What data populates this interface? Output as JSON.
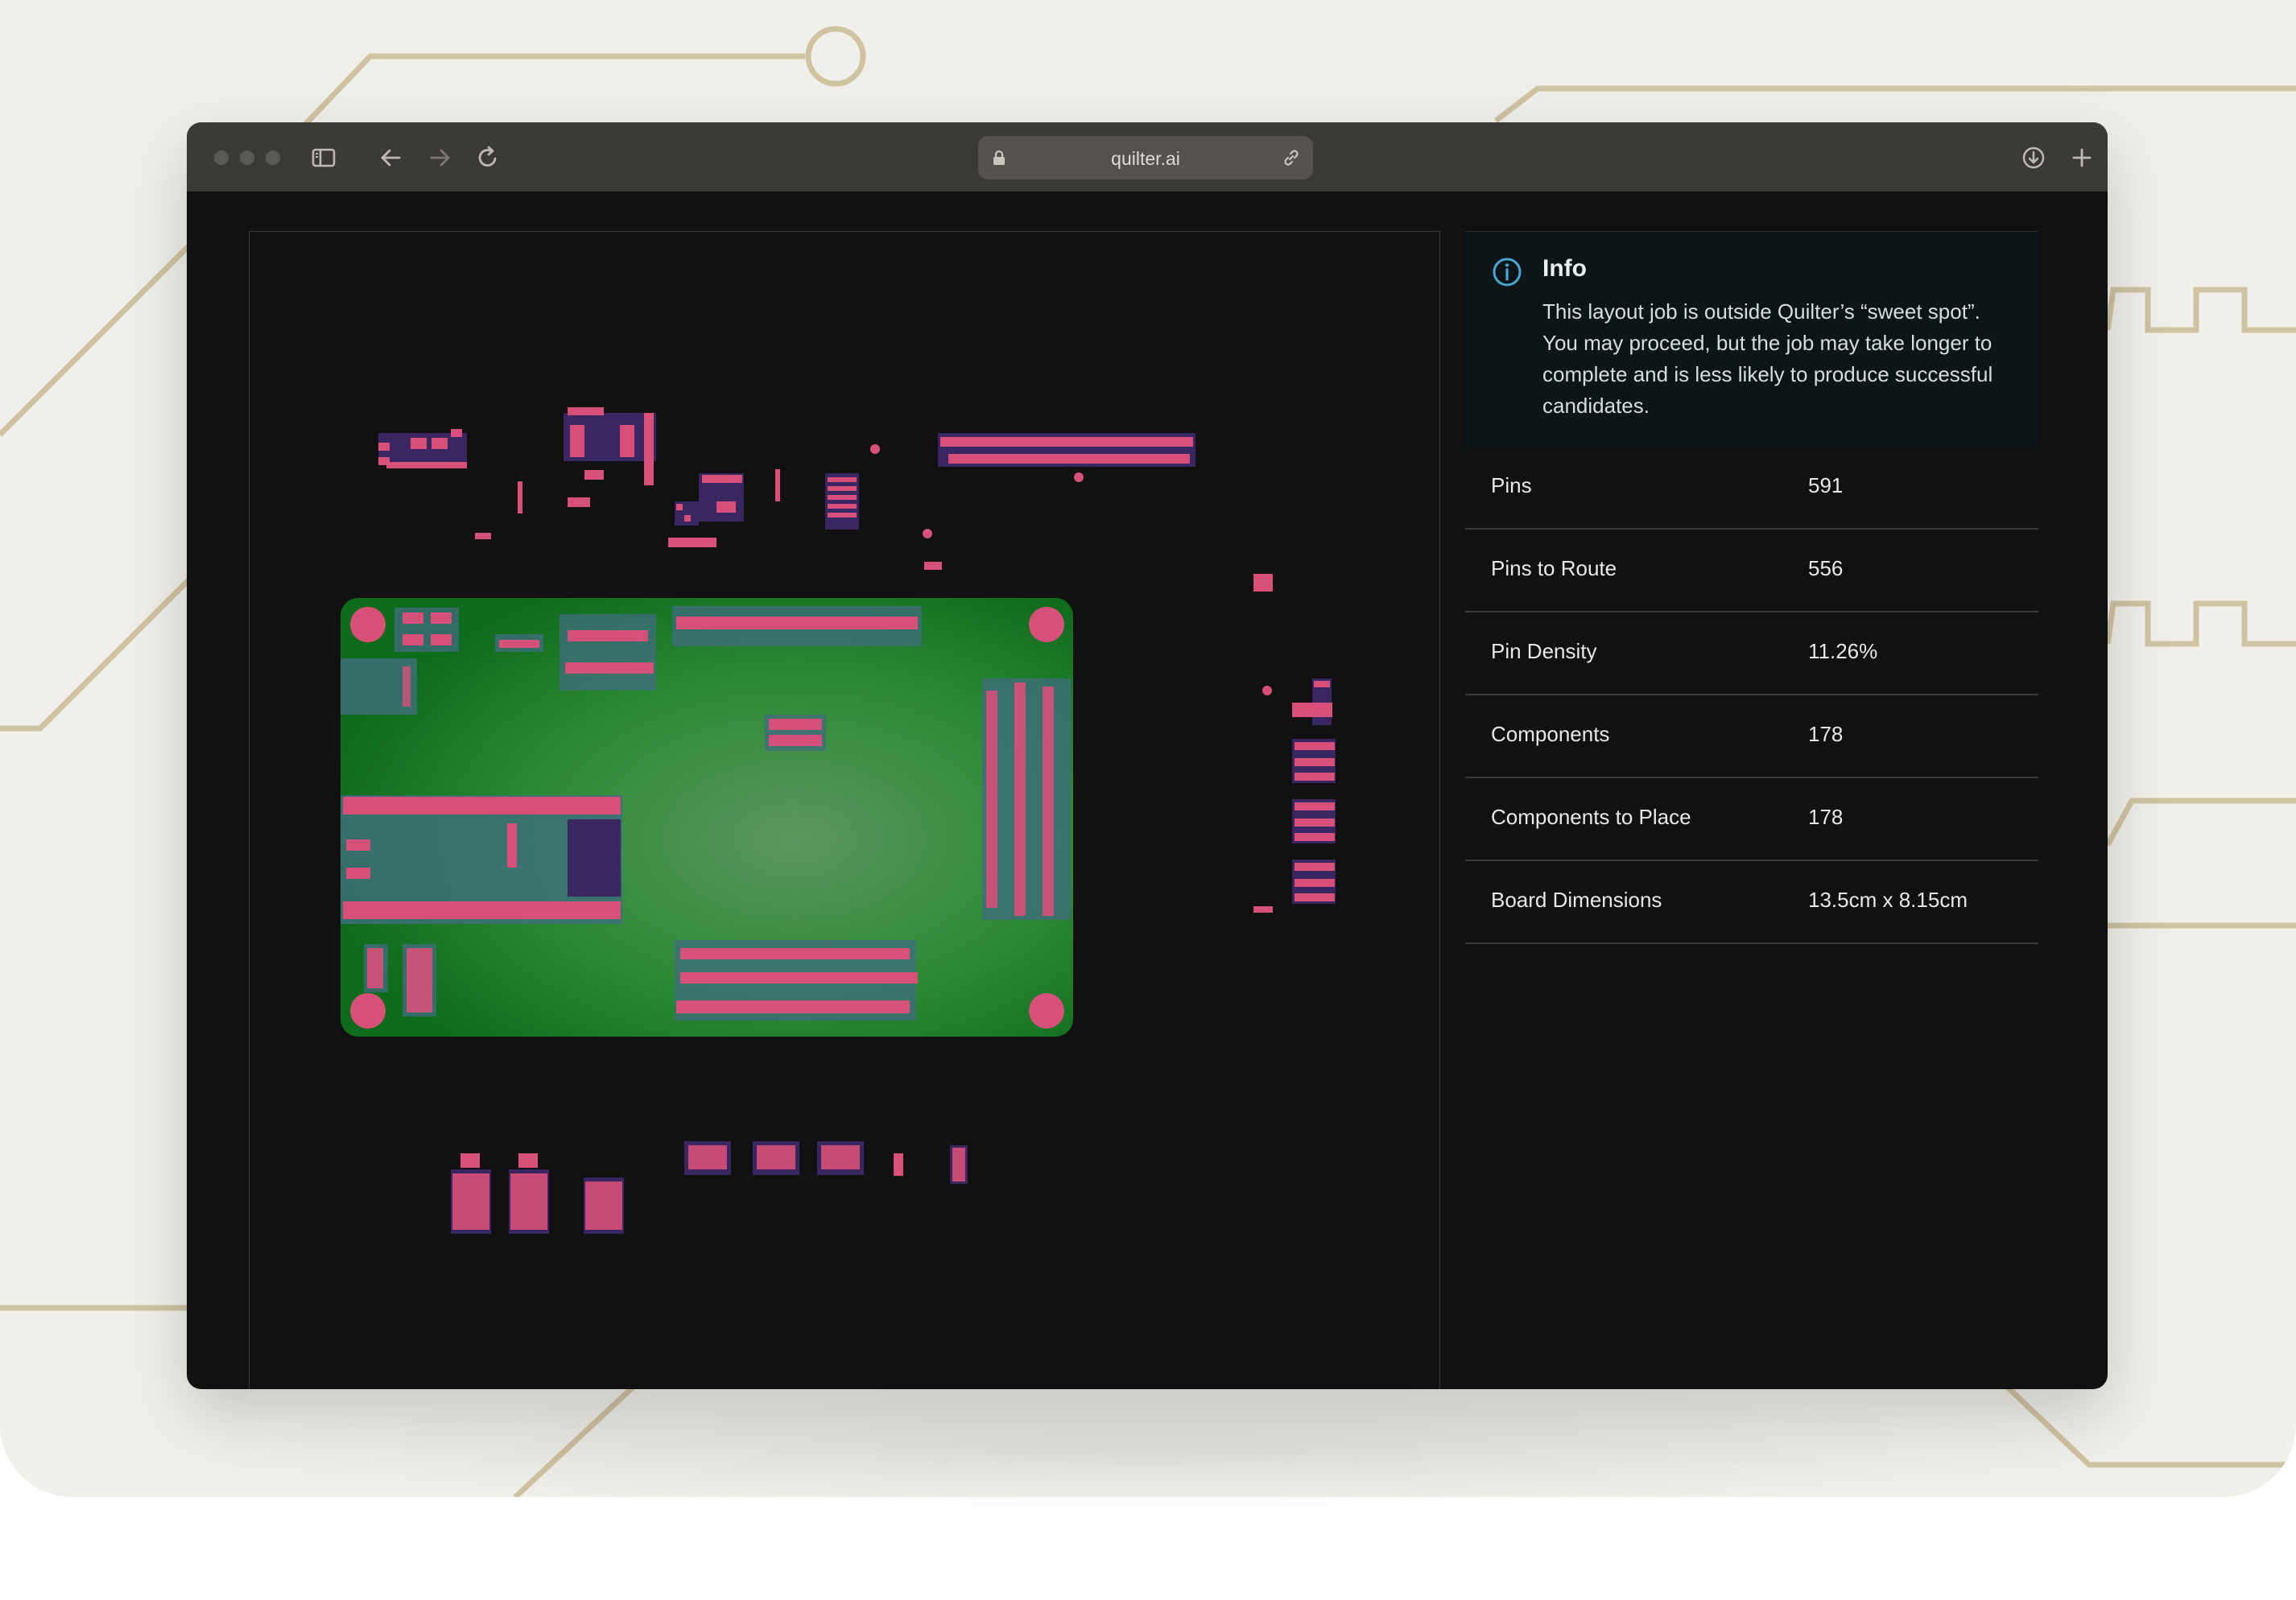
{
  "browser": {
    "url": "quilter.ai",
    "toolbar_icons": [
      "sidebar-icon",
      "back-arrow-icon",
      "forward-arrow-icon",
      "reload-icon",
      "lock-icon",
      "link-icon",
      "download-icon",
      "plus-icon"
    ]
  },
  "info": {
    "title": "Info",
    "message": "This layout job is outside Quilter’s “sweet spot”. You may proceed, but the job may take longer to complete and is less likely to produce successful candidates."
  },
  "properties": [
    {
      "label": "Pins",
      "value": "591"
    },
    {
      "label": "Pins to Route",
      "value": "556"
    },
    {
      "label": "Pin Density",
      "value": "11.26%"
    },
    {
      "label": "Components",
      "value": "178"
    },
    {
      "label": "Components to Place",
      "value": "178"
    },
    {
      "label": "Board Dimensions",
      "value": "13.5cm x 8.15cm"
    }
  ],
  "colors": {
    "background": "#f1efe9",
    "trace_decoration": "#cfc3a2",
    "toolbar": "#3c3a37",
    "canvas": "#111111",
    "board_green": "#2f9a35",
    "pad_pink": "#d7507a",
    "component_purple": "#3a2660",
    "info_accent": "#4aa6d6"
  }
}
